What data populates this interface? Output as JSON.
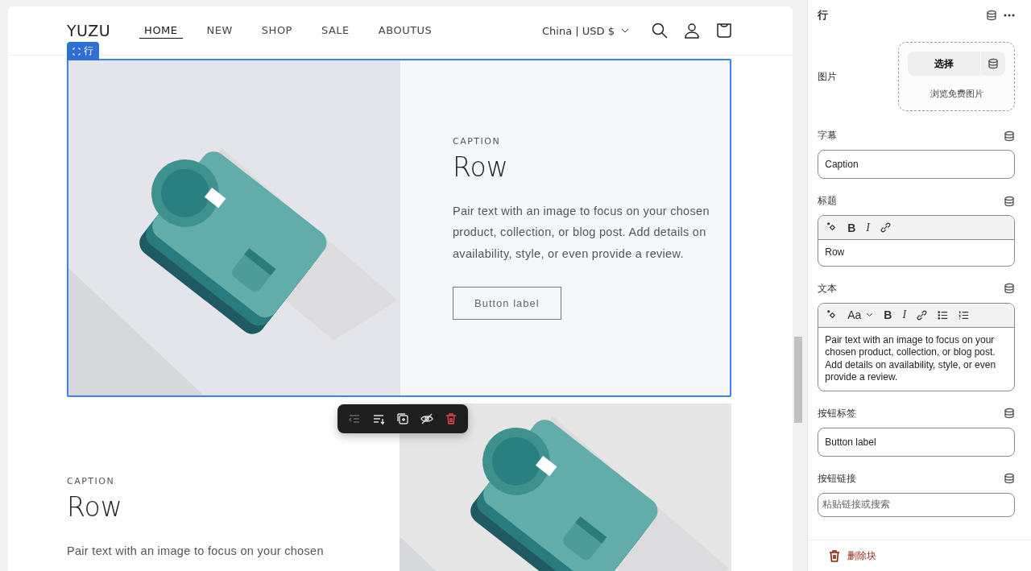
{
  "preview": {
    "header": {
      "logo": "YUZU",
      "nav": [
        {
          "label": "HOME",
          "selected": true
        },
        {
          "label": "NEW",
          "selected": false
        },
        {
          "label": "SHOP",
          "selected": false
        },
        {
          "label": "SALE",
          "selected": false
        },
        {
          "label": "ABOUTUS",
          "selected": false
        }
      ],
      "locale": "China | USD $"
    },
    "selection_label": "行",
    "rows": [
      {
        "kind": "image-left",
        "selected": true,
        "caption": "CAPTION",
        "heading": "Row",
        "body": "Pair text with an image to focus on your chosen product, collection, or blog post. Add details on availability, style, or even provide a review.",
        "button_label": "Button label"
      },
      {
        "kind": "image-right",
        "selected": false,
        "caption": "CAPTION",
        "heading": "Row",
        "body": "Pair text with an image to focus on your chosen"
      }
    ],
    "block_toolbar": [
      {
        "kind": "outdent",
        "disabled": true
      },
      {
        "kind": "move-down",
        "disabled": false
      },
      {
        "kind": "duplicate",
        "disabled": false
      },
      {
        "kind": "hide",
        "disabled": false
      },
      {
        "kind": "delete",
        "disabled": false
      }
    ]
  },
  "panel": {
    "title": "行",
    "fields": [
      {
        "label": "图片",
        "select_button": "选择",
        "browse_link": "浏览免费图片"
      },
      {
        "kind": "text",
        "label": "字幕",
        "value": "Caption"
      },
      {
        "kind": "richtext",
        "label": "标题",
        "toolbar": [
          {
            "kind": "sparkle"
          },
          {
            "kind": "bold",
            "label": "B"
          },
          {
            "kind": "italic",
            "label": "I"
          },
          {
            "kind": "link"
          }
        ],
        "value": "Row"
      },
      {
        "kind": "richtext",
        "label": "文本",
        "toolbar": [
          {
            "kind": "sparkle"
          },
          {
            "kind": "font",
            "label": "Aa"
          },
          {
            "kind": "bold",
            "label": "B"
          },
          {
            "kind": "italic",
            "label": "I"
          },
          {
            "kind": "link"
          },
          {
            "kind": "bullets"
          },
          {
            "kind": "numbers"
          }
        ],
        "value": "Pair text with an image to focus on your chosen product, collection, or blog post. Add details on availability, style, or even provide a review."
      },
      {
        "kind": "text",
        "label": "按钮标签",
        "value": "Button label"
      },
      {
        "kind": "text",
        "label": "按钮链接",
        "placeholder": "粘贴链接或搜索"
      }
    ],
    "delete_label": "删除块"
  }
}
